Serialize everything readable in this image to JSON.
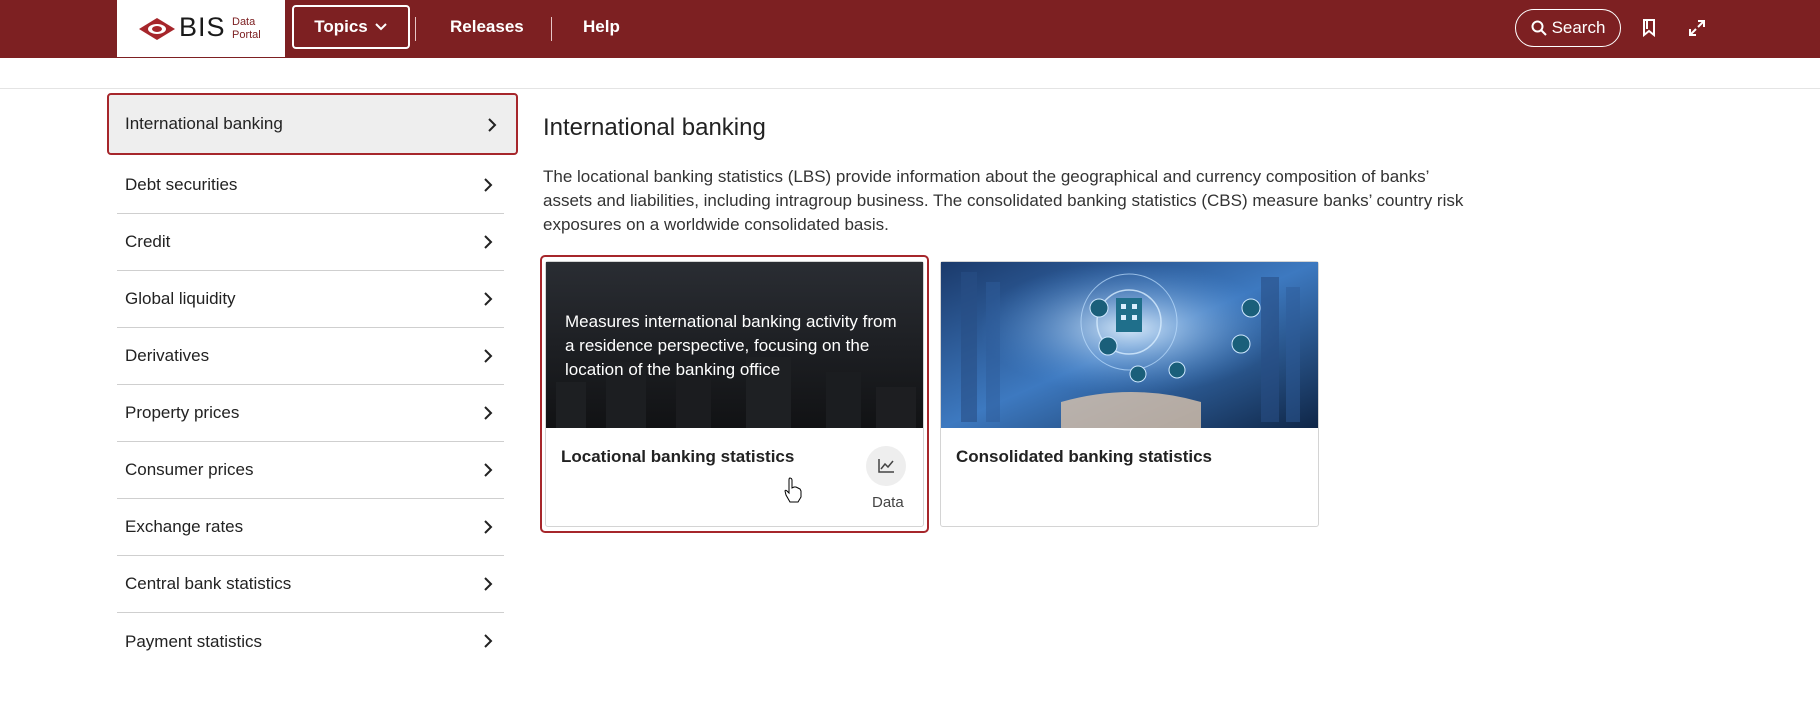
{
  "header": {
    "logo_text": "BIS",
    "logo_sub_1": "Data",
    "logo_sub_2": "Portal",
    "nav": {
      "topics": "Topics",
      "releases": "Releases",
      "help": "Help"
    },
    "search_label": "Search",
    "icons": [
      "search-icon",
      "bookmark-icon",
      "expand-icon",
      "chevron-down-icon"
    ]
  },
  "sidebar": {
    "items": [
      {
        "label": "International banking",
        "active": true
      },
      {
        "label": "Debt securities"
      },
      {
        "label": "Credit"
      },
      {
        "label": "Global liquidity"
      },
      {
        "label": "Derivatives"
      },
      {
        "label": "Property prices"
      },
      {
        "label": "Consumer prices"
      },
      {
        "label": "Exchange rates"
      },
      {
        "label": "Central bank statistics"
      },
      {
        "label": "Payment statistics"
      }
    ]
  },
  "main": {
    "title": "International banking",
    "description": "The locational banking statistics (LBS) provide information about the geographical and currency composition of banks’ assets and liabilities, including intragroup business. The consolidated banking statistics (CBS) measure banks’ country risk exposures on a worldwide consolidated basis.",
    "cards": [
      {
        "title": "Locational banking statistics",
        "overlay": "Measures international banking activity from a residence perspective, focusing on the location of the banking office",
        "data_label": "Data"
      },
      {
        "title": "Consolidated banking statistics"
      }
    ]
  },
  "colors": {
    "brand": "#7d2022",
    "accent_outline": "#a6262b"
  }
}
